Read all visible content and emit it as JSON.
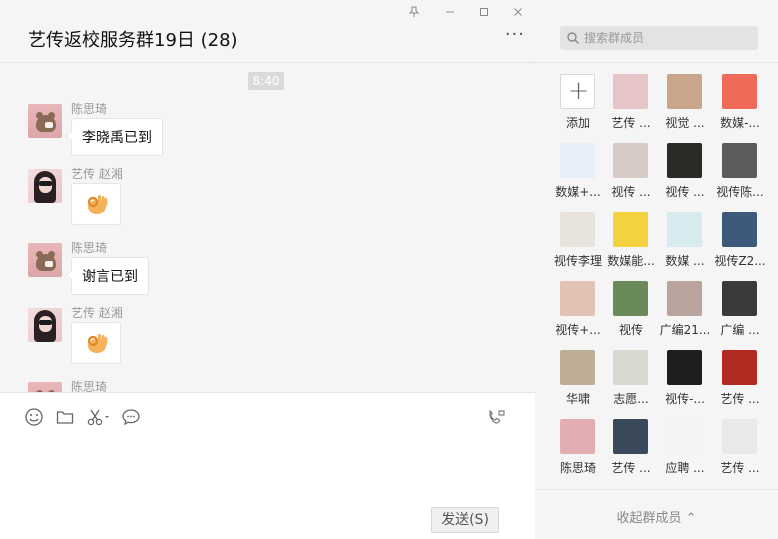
{
  "window": {
    "controls": [
      "pin-icon",
      "minimize-icon",
      "maximize-icon",
      "close-icon"
    ]
  },
  "chat": {
    "title": "艺传返校服务群19日 (28)",
    "more": "···",
    "time": "8:40",
    "messages": [
      {
        "sender": "陈思琦",
        "text": "李晓禹已到",
        "avatar": "bear"
      },
      {
        "sender": "艺传 赵湘",
        "text": "",
        "emoji": "ok-hand",
        "avatar": "girl"
      },
      {
        "sender": "陈思琦",
        "text": "谢言已到",
        "avatar": "bear"
      },
      {
        "sender": "艺传 赵湘",
        "text": "",
        "emoji": "ok-hand",
        "avatar": "girl"
      },
      {
        "sender": "陈思琦",
        "text": "",
        "avatar": "bear"
      }
    ]
  },
  "composer": {
    "tools": [
      "emoji-icon",
      "folder-icon",
      "scissors-icon",
      "chat-bubble-icon"
    ],
    "call_icon": "video-call-icon",
    "send_label": "发送(S)"
  },
  "members": {
    "search_placeholder": "搜索群成员",
    "items": [
      {
        "name": "添加",
        "type": "add"
      },
      {
        "name": "艺传 ...",
        "color": "#e6c5c9"
      },
      {
        "name": "视觉 ...",
        "color": "#c9a58c"
      },
      {
        "name": "数媒-...",
        "color": "#f06a5a"
      },
      {
        "name": "数媒+...",
        "color": "#e8eef7"
      },
      {
        "name": "视传 ...",
        "color": "#d8cbc5"
      },
      {
        "name": "视传 ...",
        "color": "#2c2a26"
      },
      {
        "name": "视传陈...",
        "color": "#5c5c5c"
      },
      {
        "name": "视传李理",
        "color": "#e8e3dc"
      },
      {
        "name": "数媒能...",
        "color": "#f2d23e"
      },
      {
        "name": "数媒 ...",
        "color": "#d6eaf0"
      },
      {
        "name": "视传Z2...",
        "color": "#3d5a7a"
      },
      {
        "name": "视传+...",
        "color": "#e2c2b4"
      },
      {
        "name": "视传",
        "color": "#6a8a5a"
      },
      {
        "name": "广编21...",
        "color": "#b9a59d"
      },
      {
        "name": "广编 ...",
        "color": "#3a3a3a"
      },
      {
        "name": "华啸",
        "color": "#bfae97"
      },
      {
        "name": "志愿...",
        "color": "#d5d9cf"
      },
      {
        "name": "视传-...",
        "color": "#1e1e1e"
      },
      {
        "name": "艺传 ...",
        "color": "#b12b23"
      },
      {
        "name": "陈思琦",
        "color": "#e2aeb1"
      },
      {
        "name": "艺传 ...",
        "color": "#3b4a5a"
      },
      {
        "name": "应聘 ...",
        "color": "#f4f4f4"
      },
      {
        "name": "艺传 ...",
        "color": "#e9e9e9"
      }
    ],
    "collapse_label": "收起群成员 ⌃"
  }
}
